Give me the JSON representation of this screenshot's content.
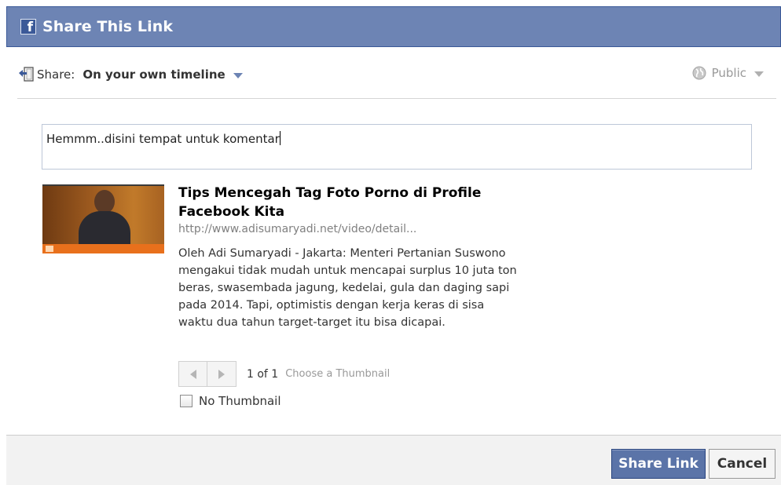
{
  "dialog": {
    "title": "Share This Link",
    "logo_letter": "f"
  },
  "share_bar": {
    "label": "Share:",
    "target": "On your own timeline",
    "privacy": "Public"
  },
  "comment": {
    "value": "Hemmm..disini tempat untuk komentar"
  },
  "link_preview": {
    "title": "Tips Mencegah Tag Foto Porno di Profile Facebook Kita",
    "url": "http://www.adisumaryadi.net/video/detail...",
    "description": "Oleh Adi Sumaryadi - Jakarta: Menteri Pertanian Suswono mengakui tidak mudah untuk mencapai surplus 10 juta ton beras, swasembada jagung, kedelai, gula dan daging sapi pada 2014. Tapi, optimistis dengan kerja keras di sisa waktu dua tahun target-target itu bisa dicapai.",
    "page_count": "1 of 1",
    "choose_thumbnail": "Choose a Thumbnail",
    "no_thumbnail_label": "No Thumbnail"
  },
  "footer": {
    "share_button": "Share Link",
    "cancel_button": "Cancel"
  },
  "colors": {
    "titlebar": "#6d84b4",
    "primary_button": "#5b74a8",
    "brand": "#3b5998"
  },
  "icons": [
    "facebook-logo-icon",
    "share-icon",
    "dropdown-caret-icon",
    "globe-icon",
    "prev-arrow-icon",
    "next-arrow-icon"
  ]
}
